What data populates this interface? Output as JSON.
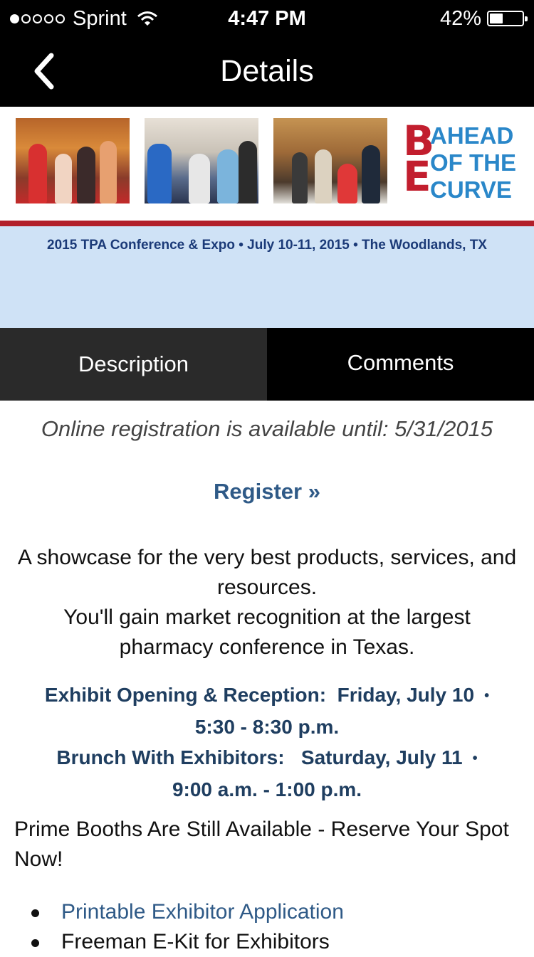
{
  "status_bar": {
    "carrier": "Sprint",
    "time": "4:47 PM",
    "battery": "42%",
    "battery_level": 0.42,
    "signal_bars_filled": 1,
    "signal_bars_total": 5,
    "icons": [
      "signal-dots-icon",
      "wifi-icon",
      "battery-icon"
    ]
  },
  "nav": {
    "title": "Details",
    "back_icon": "chevron-left-icon"
  },
  "banner": {
    "logo_letters": {
      "first": "B",
      "second": "E"
    },
    "logo_lines": [
      "AHEAD",
      "OF THE",
      "CURVE"
    ],
    "caption": "2015 TPA Conference & Expo • July 10-11, 2015 • The Woodlands, TX",
    "colors": {
      "logo_red": "#c21e2e",
      "logo_blue": "#2a87c9",
      "rule_red": "#b21f2a",
      "band_blue": "#cfe2f6"
    }
  },
  "tabs": [
    {
      "label": "Description",
      "active": true
    },
    {
      "label": "Comments",
      "active": false
    }
  ],
  "content": {
    "registration_note": "Online registration is available until: 5/31/2015",
    "register_link": "Register »",
    "showcase_line1": "A showcase for the very best products, services, and resources.",
    "showcase_line2": "You'll gain market recognition at the largest pharmacy conference in Texas.",
    "events": [
      {
        "title": "Exhibit Opening & Reception:",
        "day": "Friday, July 10",
        "sep": "•",
        "time": "5:30 - 8:30 p.m."
      },
      {
        "title": "Brunch With Exhibitors:",
        "day": "Saturday, July 11",
        "sep": "•",
        "time": "9:00 a.m. - 1:00 p.m."
      }
    ],
    "prime_booths": "Prime Booths Are Still Available - Reserve Your Spot Now!",
    "links": [
      {
        "label": "Printable Exhibitor Application",
        "is_link": true
      },
      {
        "label": "Freeman E-Kit for Exhibitors",
        "is_link": false
      }
    ]
  }
}
